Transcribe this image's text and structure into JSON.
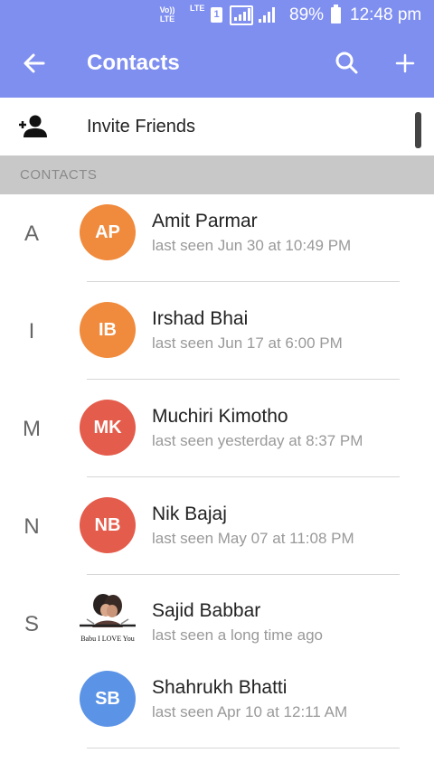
{
  "status_bar": {
    "volte": "Vo)) LTE",
    "lte": "LTE",
    "sim": "1",
    "battery_percent": "89%",
    "time": "12:48 pm"
  },
  "toolbar": {
    "title": "Contacts",
    "back_icon": "arrow-left-icon",
    "search_icon": "search-icon",
    "add_icon": "plus-icon",
    "color": "#7f8ff0"
  },
  "invite": {
    "label": "Invite Friends",
    "icon": "person-add-icon"
  },
  "section": {
    "label": "CONTACTS"
  },
  "contacts": [
    {
      "letter": "A",
      "initials": "AP",
      "name": "Amit Parmar",
      "status": "last seen Jun 30 at 10:49 PM",
      "color": "#f08a3c"
    },
    {
      "letter": "I",
      "initials": "IB",
      "name": "Irshad Bhai",
      "status": "last seen Jun 17 at 6:00 PM",
      "color": "#f08a3c"
    },
    {
      "letter": "M",
      "initials": "MK",
      "name": "Muchiri Kimotho",
      "status": "last seen yesterday at 8:37 PM",
      "color": "#e45c4b"
    },
    {
      "letter": "N",
      "initials": "NB",
      "name": "Nik Bajaj",
      "status": "last seen May 07 at 11:08 PM",
      "color": "#e45c4b"
    },
    {
      "letter": "S",
      "initials": "",
      "name": "Sajid Babbar",
      "status": "last seen a long time ago",
      "photo_caption": "Babu I LOVE You"
    },
    {
      "letter": "",
      "initials": "SB",
      "name": "Shahrukh Bhatti",
      "status": "last seen Apr 10 at 12:11 AM",
      "color": "#5b93e6"
    }
  ]
}
